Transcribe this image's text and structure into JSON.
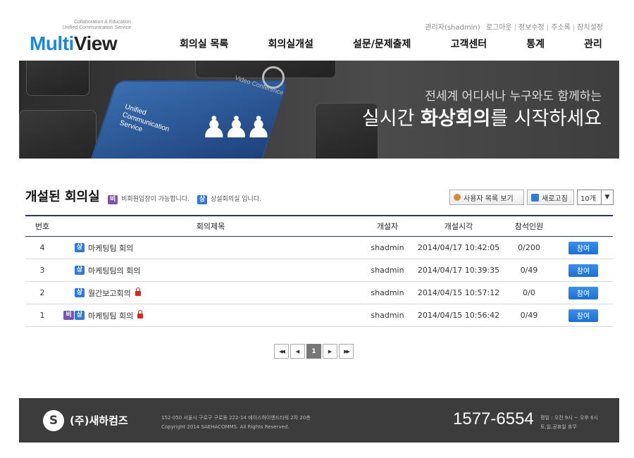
{
  "logo": {
    "tagline1": "Collaboration & Education",
    "tagline2": "Unified Communication Service",
    "word_multi": "Multi",
    "word_view": "View"
  },
  "util_links": [
    "관리자(shadmin)",
    "로그아웃",
    "정보수정",
    "주소록",
    "장치설정"
  ],
  "nav": [
    "회의실 목록",
    "회의실개설",
    "설문/문제출제",
    "고객센터",
    "통계",
    "관리"
  ],
  "banner": {
    "key_text_1": "Unified",
    "key_text_2": "Communication",
    "key_text_3": "Service",
    "cam_text": "Video Conference",
    "slogan1": "전세계 어디서나 누구와도 함께하는",
    "slogan2_pre": "실시간 ",
    "slogan2_bold": "화상회의",
    "slogan2_post": "를 시작하세요"
  },
  "section": {
    "title": "개설된 회의실",
    "legend_nonmember_badge": "비",
    "legend_nonmember_text": "비회원입장이 가능합니다.",
    "legend_permanent_badge": "상",
    "legend_permanent_text": "상설회의실 입니다.",
    "btn_users": "사용자 목록 보기",
    "btn_refresh": "새로고침",
    "page_size": "10개"
  },
  "table": {
    "headers": {
      "no": "번호",
      "title": "회의제목",
      "owner": "개설자",
      "time": "개설시각",
      "attendees": "참석인원"
    },
    "rows": [
      {
        "no": "4",
        "badges": [
          "상"
        ],
        "title": "마케팅팀 회의",
        "locked": false,
        "owner": "shadmin",
        "time": "2014/04/17 10:42:05",
        "attendees": "0/200",
        "action": "참여"
      },
      {
        "no": "3",
        "badges": [
          "상"
        ],
        "title": "마케팅팀의 회의",
        "locked": false,
        "owner": "shadmin",
        "time": "2014/04/17 10:39:35",
        "attendees": "0/49",
        "action": "참여"
      },
      {
        "no": "2",
        "badges": [
          "상"
        ],
        "title": "월간보고회의",
        "locked": true,
        "owner": "shadmin",
        "time": "2014/04/15 10:57:12",
        "attendees": "0/0",
        "action": "참여"
      },
      {
        "no": "1",
        "badges": [
          "비",
          "상"
        ],
        "title": "마케팅팀 회의",
        "locked": true,
        "owner": "shadmin",
        "time": "2014/04/15 10:56:42",
        "attendees": "0/49",
        "action": "참여"
      }
    ]
  },
  "pager": {
    "first": "◀◀",
    "prev": "◀",
    "current": "1",
    "next": "▶",
    "last": "▶▶"
  },
  "footer": {
    "mark": "S",
    "company": "(주)새하컴즈",
    "address": "152-050 서울시 구로구 구로동 222-14 에이스하이엔드타워 2차 20층",
    "copyright": "Copyright 2014 SAEHACOMMS. All Rights Reserved.",
    "phone": "1577-6554",
    "hours1": "평일 : 오전 9시 ~ 오후 6시",
    "hours2": "토,일,공휴일 휴무"
  },
  "colors": {
    "brand_blue": "#1f88d8",
    "badge_purple": "#7a55b0",
    "badge_blue": "#2f7ad6",
    "join_button": "#1f6fd0",
    "footer_bg": "#3c3c3c"
  }
}
